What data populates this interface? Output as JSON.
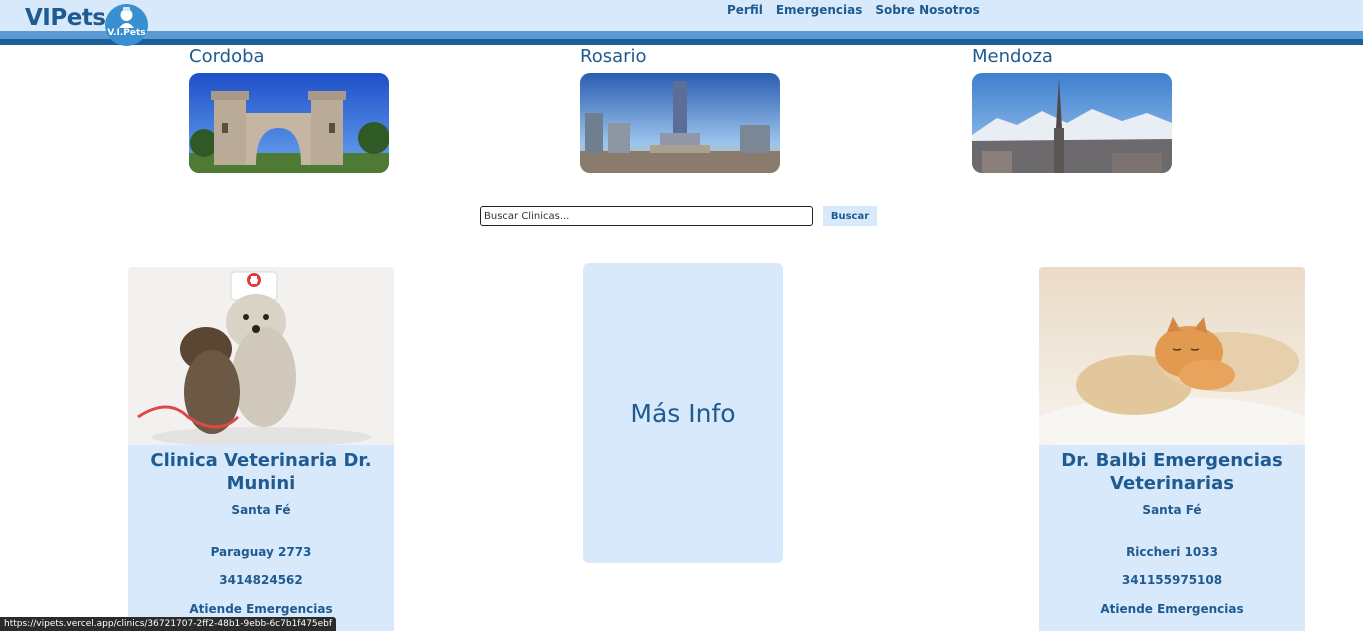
{
  "header": {
    "logo_text": "VIPets",
    "logo_badge_text": "V.I.Pets",
    "nav": [
      "Perfil",
      "Emergencias",
      "Sobre Nosotros"
    ]
  },
  "cities": [
    {
      "name": "Cordoba",
      "image": "cordoba-arch-photo"
    },
    {
      "name": "Rosario",
      "image": "rosario-monument-photo"
    },
    {
      "name": "Mendoza",
      "image": "mendoza-mountains-photo"
    }
  ],
  "search": {
    "placeholder": "Buscar Clinicas...",
    "button_label": "Buscar"
  },
  "clinics": [
    {
      "image": "dogs-with-nurse-hat-photo",
      "name": "Clinica Veterinaria Dr. Munini",
      "province": "Santa Fé",
      "address": "Paraguay 2773",
      "phone": "3414824562",
      "emergency": "Atiende Emergencias"
    },
    {
      "image": "puppy-and-kitten-sleeping-photo",
      "name": "Dr. Balbi Emergencias Veterinarias",
      "province": "Santa Fé",
      "address": "Riccheri 1033",
      "phone": "341155975108",
      "emergency": "Atiende Emergencias"
    }
  ],
  "more_info_label": "Más Info",
  "status_url": "https://vipets.vercel.app/clinics/36721707-2ff2-48b1-9ebb-6c7b1f475ebf",
  "colors": {
    "brand": "#1f5a91",
    "panel": "#d7e9fb",
    "band": "#5b9bd5"
  }
}
